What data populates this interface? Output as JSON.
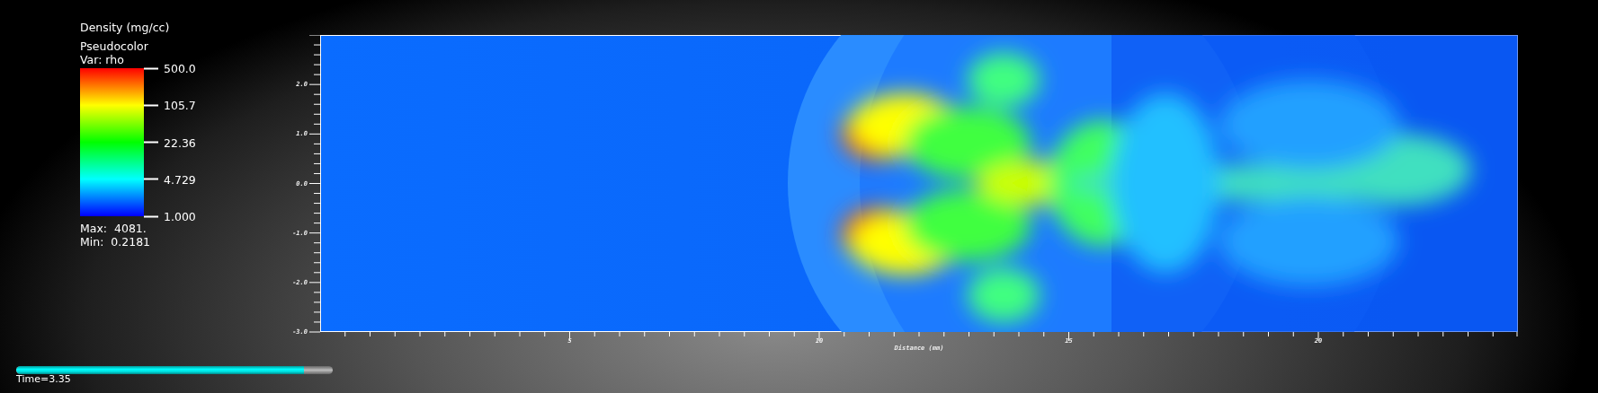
{
  "legend": {
    "title": "Density (mg/cc)",
    "plot_type": "Pseudocolor",
    "variable": "Var: rho",
    "ticks": [
      "500.0",
      "105.7",
      "22.36",
      "4.729",
      "1.000"
    ],
    "max": "Max:  4081.",
    "min": "Min:  0.2181"
  },
  "plot": {
    "x_axis": {
      "title": "Distance (mm)",
      "ticks": [
        "5",
        "10",
        "15",
        "20"
      ]
    },
    "y_axis": {
      "ticks": [
        "2.0",
        "1.0",
        "0.0",
        "-1.0",
        "-2.0",
        "-3.0"
      ]
    }
  },
  "time_slider": {
    "level": 0.91,
    "label": "Time=3.35"
  }
}
